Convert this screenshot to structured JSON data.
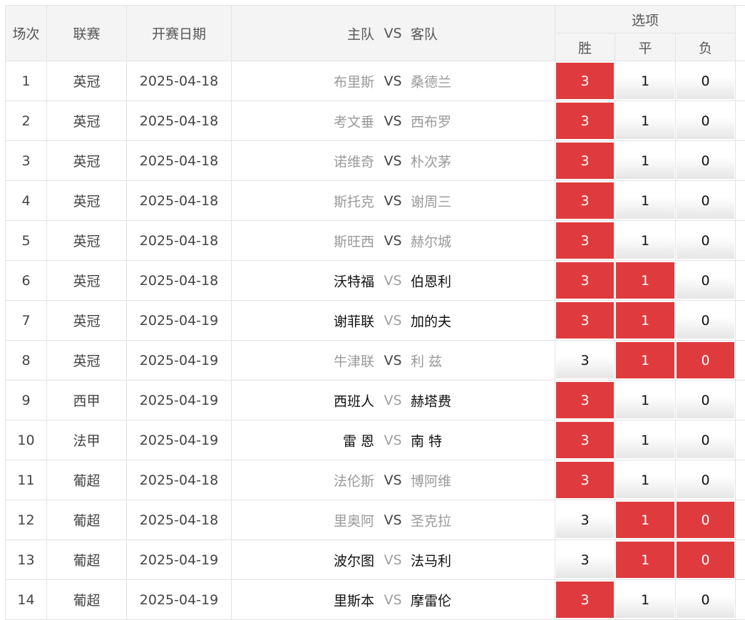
{
  "header": {
    "col_index": "场次",
    "col_league": "联赛",
    "col_date": "开赛日期",
    "col_home": "主队",
    "col_vs": "VS",
    "col_away": "客队",
    "col_options": "选项",
    "opt_win": "胜",
    "opt_draw": "平",
    "opt_lose": "负"
  },
  "colors": {
    "selected": "#df3b3e",
    "unselected_top": "#ffffff",
    "unselected_bottom": "#e6e6e6",
    "header_bg": "#f4f4f4",
    "border": "#e3e3e3"
  },
  "rows": [
    {
      "no": "1",
      "league": "英冠",
      "date": "2025-04-18",
      "home": "布里斯",
      "vs": "VS",
      "away": "桑德兰",
      "emph": false,
      "o3": "3",
      "o1": "1",
      "o0": "0",
      "sel": [
        true,
        false,
        false
      ]
    },
    {
      "no": "2",
      "league": "英冠",
      "date": "2025-04-18",
      "home": "考文垂",
      "vs": "VS",
      "away": "西布罗",
      "emph": false,
      "o3": "3",
      "o1": "1",
      "o0": "0",
      "sel": [
        true,
        false,
        false
      ]
    },
    {
      "no": "3",
      "league": "英冠",
      "date": "2025-04-18",
      "home": "诺维奇",
      "vs": "VS",
      "away": "朴次茅",
      "emph": false,
      "o3": "3",
      "o1": "1",
      "o0": "0",
      "sel": [
        true,
        false,
        false
      ]
    },
    {
      "no": "4",
      "league": "英冠",
      "date": "2025-04-18",
      "home": "斯托克",
      "vs": "VS",
      "away": "谢周三",
      "emph": false,
      "o3": "3",
      "o1": "1",
      "o0": "0",
      "sel": [
        true,
        false,
        false
      ]
    },
    {
      "no": "5",
      "league": "英冠",
      "date": "2025-04-18",
      "home": "斯旺西",
      "vs": "VS",
      "away": "赫尔城",
      "emph": false,
      "o3": "3",
      "o1": "1",
      "o0": "0",
      "sel": [
        true,
        false,
        false
      ]
    },
    {
      "no": "6",
      "league": "英冠",
      "date": "2025-04-18",
      "home": "沃特福",
      "vs": "VS",
      "away": "伯恩利",
      "emph": true,
      "o3": "3",
      "o1": "1",
      "o0": "0",
      "sel": [
        true,
        true,
        false
      ]
    },
    {
      "no": "7",
      "league": "英冠",
      "date": "2025-04-19",
      "home": "谢菲联",
      "vs": "VS",
      "away": "加的夫",
      "emph": true,
      "o3": "3",
      "o1": "1",
      "o0": "0",
      "sel": [
        true,
        true,
        false
      ]
    },
    {
      "no": "8",
      "league": "英冠",
      "date": "2025-04-19",
      "home": "牛津联",
      "vs": "VS",
      "away": "利 兹",
      "emph": false,
      "o3": "3",
      "o1": "1",
      "o0": "0",
      "sel": [
        false,
        true,
        true
      ]
    },
    {
      "no": "9",
      "league": "西甲",
      "date": "2025-04-19",
      "home": "西班人",
      "vs": "VS",
      "away": "赫塔费",
      "emph": true,
      "o3": "3",
      "o1": "1",
      "o0": "0",
      "sel": [
        true,
        false,
        false
      ]
    },
    {
      "no": "10",
      "league": "法甲",
      "date": "2025-04-19",
      "home": "雷 恩",
      "vs": "VS",
      "away": "南 特",
      "emph": true,
      "o3": "3",
      "o1": "1",
      "o0": "0",
      "sel": [
        true,
        false,
        false
      ]
    },
    {
      "no": "11",
      "league": "葡超",
      "date": "2025-04-18",
      "home": "法伦斯",
      "vs": "VS",
      "away": "博阿维",
      "emph": false,
      "o3": "3",
      "o1": "1",
      "o0": "0",
      "sel": [
        true,
        false,
        false
      ]
    },
    {
      "no": "12",
      "league": "葡超",
      "date": "2025-04-18",
      "home": "里奥阿",
      "vs": "VS",
      "away": "圣克拉",
      "emph": false,
      "o3": "3",
      "o1": "1",
      "o0": "0",
      "sel": [
        false,
        true,
        true
      ]
    },
    {
      "no": "13",
      "league": "葡超",
      "date": "2025-04-19",
      "home": "波尔图",
      "vs": "VS",
      "away": "法马利",
      "emph": true,
      "o3": "3",
      "o1": "1",
      "o0": "0",
      "sel": [
        false,
        true,
        true
      ]
    },
    {
      "no": "14",
      "league": "葡超",
      "date": "2025-04-19",
      "home": "里斯本",
      "vs": "VS",
      "away": "摩雷伦",
      "emph": true,
      "o3": "3",
      "o1": "1",
      "o0": "0",
      "sel": [
        true,
        false,
        false
      ]
    }
  ]
}
